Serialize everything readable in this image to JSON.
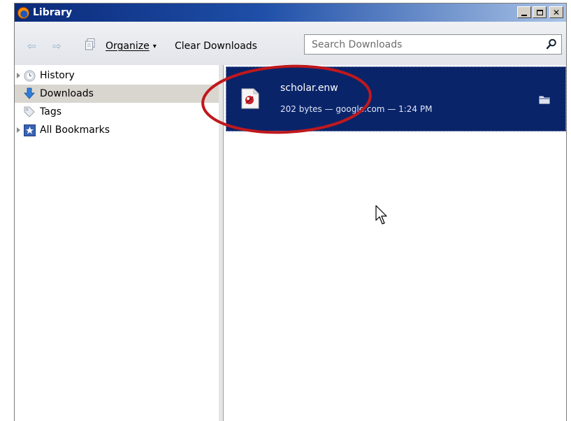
{
  "window": {
    "title": "Library"
  },
  "toolbar": {
    "organize_label": "Organize",
    "organize_dropdown": "▾",
    "clear_label": "Clear Downloads",
    "search": {
      "placeholder": "Search Downloads",
      "value": ""
    }
  },
  "sidebar": {
    "items": [
      {
        "label": "History",
        "icon": "history-clock-icon",
        "expandable": true
      },
      {
        "label": "Downloads",
        "icon": "downloads-arrow-icon",
        "expandable": false,
        "selected": true
      },
      {
        "label": "Tags",
        "icon": "tag-icon",
        "expandable": false
      },
      {
        "label": "All Bookmarks",
        "icon": "bookmarks-star-icon",
        "expandable": true
      }
    ]
  },
  "downloads": [
    {
      "name": "scholar.enw",
      "meta": "202 bytes — google.com — 1:24 PM",
      "icon": "file-type-icon",
      "selected": true
    }
  ],
  "colors": {
    "selection": "#0a246a",
    "sidebar_selection": "#d9d6cf",
    "annotation": "#c0181c",
    "titlebar_start": "#0a2a7a",
    "titlebar_end": "#a9c3e6"
  }
}
